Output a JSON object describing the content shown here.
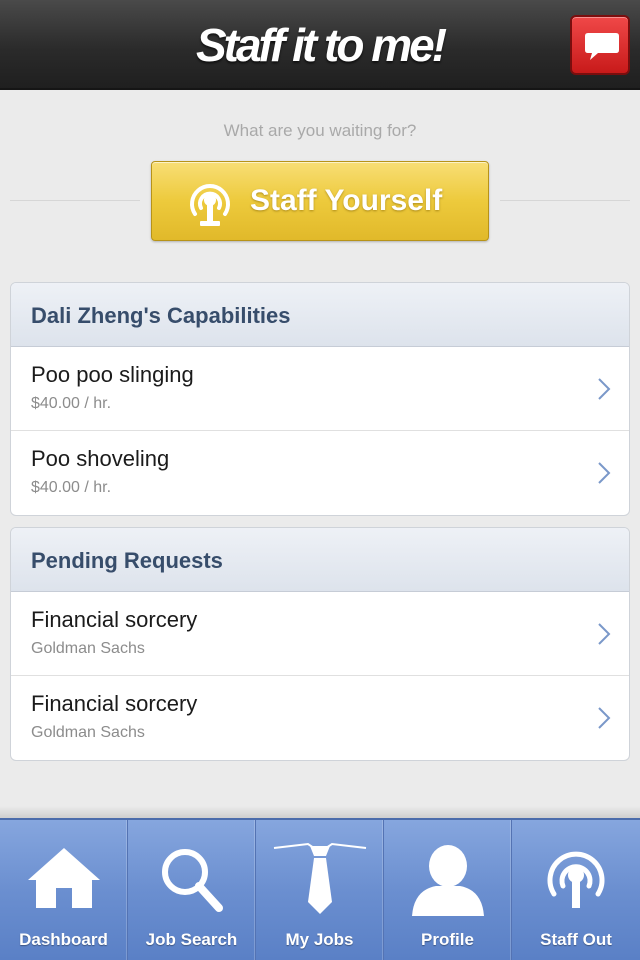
{
  "header": {
    "logo_text": "Staff it to me!",
    "chat_icon": "chat-bubble-icon"
  },
  "intro": {
    "prompt": "What are you waiting for?",
    "staff_button_label": "Staff Yourself",
    "staff_button_icon": "broadcast-icon"
  },
  "capabilities": {
    "heading": "Dali Zheng's Capabilities",
    "items": [
      {
        "title": "Poo poo slinging",
        "subtitle": "$40.00 / hr."
      },
      {
        "title": "Poo shoveling",
        "subtitle": "$40.00 / hr."
      }
    ]
  },
  "pending": {
    "heading": "Pending Requests",
    "items": [
      {
        "title": "Financial sorcery",
        "subtitle": "Goldman Sachs"
      },
      {
        "title": "Financial sorcery",
        "subtitle": "Goldman Sachs"
      }
    ]
  },
  "tabbar": {
    "tabs": [
      {
        "label": "Dashboard",
        "icon": "home-icon"
      },
      {
        "label": "Job Search",
        "icon": "magnifier-icon"
      },
      {
        "label": "My Jobs",
        "icon": "necktie-icon"
      },
      {
        "label": "Profile",
        "icon": "person-icon"
      },
      {
        "label": "Staff Out",
        "icon": "broadcast-icon"
      }
    ]
  },
  "colors": {
    "header_bg": "#2b2b2b",
    "chat_button": "#d92626",
    "staff_button": "#edca3c",
    "panel_heading_text": "#374d6b",
    "tabbar_bg": "#6b8fd0"
  }
}
